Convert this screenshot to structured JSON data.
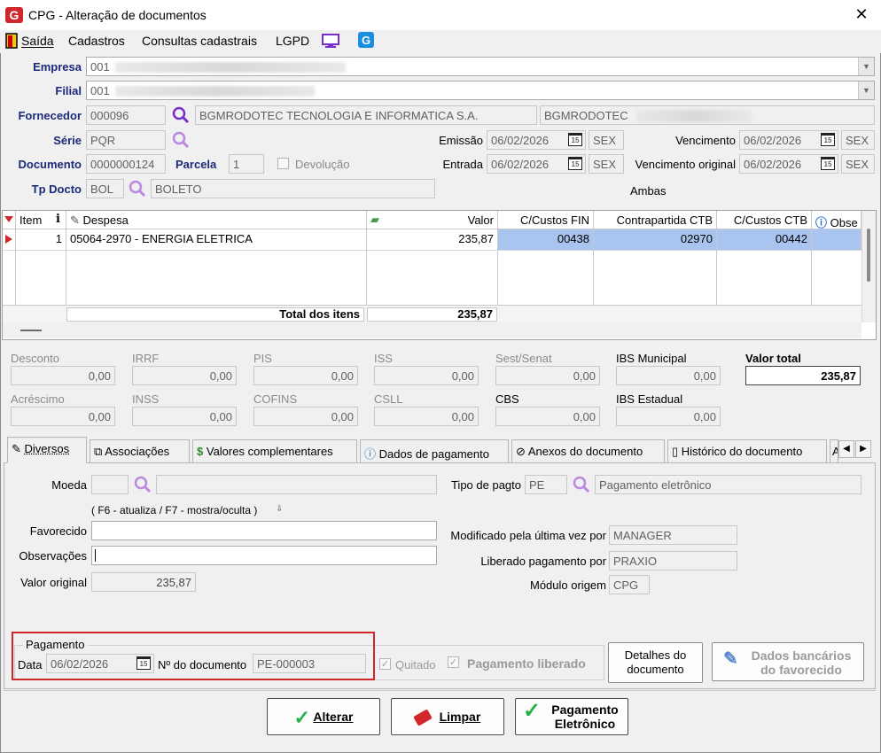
{
  "window": {
    "title": "CPG - Alteração de documentos",
    "close_symbol": "✕"
  },
  "menu": {
    "saida": "Saída",
    "cadastros": "Cadastros",
    "consultas": "Consultas cadastrais",
    "lgpd": "LGPD"
  },
  "header": {
    "empresa_label": "Empresa",
    "empresa_value": "001",
    "filial_label": "Filial",
    "filial_value": "001",
    "fornecedor_label": "Fornecedor",
    "fornecedor_code": "000096",
    "fornecedor_name": "BGMRODOTEC TECNOLOGIA E INFORMATICA S.A.",
    "fornecedor_short": "BGMRODOTEC",
    "serie_label": "Série",
    "serie_value": "PQR",
    "emissao_label": "Emissão",
    "emissao_value": "06/02/2026",
    "emissao_day": "SEX",
    "vencimento_label": "Vencimento",
    "vencimento_value": "06/02/2026",
    "vencimento_day": "SEX",
    "documento_label": "Documento",
    "documento_value": "0000000124",
    "parcela_label": "Parcela",
    "parcela_value": "1",
    "devolucao_label": "Devolução",
    "entrada_label": "Entrada",
    "entrada_value": "06/02/2026",
    "entrada_day": "SEX",
    "venc_original_label": "Vencimento original",
    "venc_original_value": "06/02/2026",
    "venc_original_day": "SEX",
    "tpdocto_label": "Tp Docto",
    "tpdocto_code": "BOL",
    "tpdocto_name": "BOLETO",
    "ambas_label": "Ambas",
    "cal_text": "15"
  },
  "grid": {
    "headers": {
      "item": "Item",
      "despesa": "Despesa",
      "valor": "Valor",
      "cc_fin": "C/Custos FIN",
      "contrapartida": "Contrapartida CTB",
      "cc_ctb": "C/Custos CTB",
      "obs": "Obse"
    },
    "rows": [
      {
        "item": "1",
        "despesa": "05064-2970 - ENERGIA ELETRICA",
        "valor": "235,87",
        "cc_fin": "00438",
        "contrapartida": "02970",
        "cc_ctb": "00442"
      }
    ],
    "total_label": "Total dos itens",
    "total_value": "235,87"
  },
  "totals": {
    "desconto_label": "Desconto",
    "desconto": "0,00",
    "irrf_label": "IRRF",
    "irrf": "0,00",
    "pis_label": "PIS",
    "pis": "0,00",
    "iss_label": "ISS",
    "iss": "0,00",
    "sest_label": "Sest/Senat",
    "sest": "0,00",
    "ibs_mun_label": "IBS Municipal",
    "ibs_mun": "0,00",
    "valor_total_label": "Valor total",
    "valor_total": "235,87",
    "acrescimo_label": "Acréscimo",
    "acrescimo": "0,00",
    "inss_label": "INSS",
    "inss": "0,00",
    "cofins_label": "COFINS",
    "cofins": "0,00",
    "csll_label": "CSLL",
    "csll": "0,00",
    "cbs_label": "CBS",
    "cbs": "0,00",
    "ibs_est_label": "IBS Estadual",
    "ibs_est": "0,00"
  },
  "tabs": [
    {
      "label": "Diversos"
    },
    {
      "label": "Associações"
    },
    {
      "label": "Valores complementares"
    },
    {
      "label": "Dados de pagamento"
    },
    {
      "label": "Anexos do documento"
    },
    {
      "label": "Histórico do documento"
    },
    {
      "label": "A"
    }
  ],
  "diversos": {
    "moeda_label": "Moeda",
    "moeda_code": "",
    "tipo_pagto_label": "Tipo de pagto",
    "tipo_pagto_code": "PE",
    "tipo_pagto_name": "Pagamento eletrônico",
    "hint": "( F6 - atualiza / F7 - mostra/oculta )",
    "favorecido_label": "Favorecido",
    "favorecido_value": "",
    "observacoes_label": "Observações",
    "observacoes_value": "",
    "valor_original_label": "Valor original",
    "valor_original_value": "235,87",
    "modificado_label": "Modificado pela última vez por",
    "modificado_value": "MANAGER",
    "liberado_label": "Liberado pagamento por",
    "liberado_value": "PRAXIO",
    "modulo_label": "Módulo origem",
    "modulo_value": "CPG"
  },
  "pagamento": {
    "group_label": "Pagamento",
    "data_label": "Data",
    "data_value": "06/02/2026",
    "ndoc_label": "Nº do documento",
    "ndoc_value": "PE-000003",
    "quitado_label": "Quitado",
    "liberado_label": "Pagamento liberado"
  },
  "buttons": {
    "detalhes": "Detalhes do documento",
    "dados_bancarios": "Dados bancários do favorecido",
    "alterar": "Alterar",
    "limpar": "Limpar",
    "pagamento_eletronico": "Pagamento Eletrônico"
  },
  "colors": {
    "accent_blue": "#1b2a7a",
    "highlight_red": "#d0272d",
    "selection": "#a9c4ee",
    "search_purple": "#7a2dc8"
  }
}
